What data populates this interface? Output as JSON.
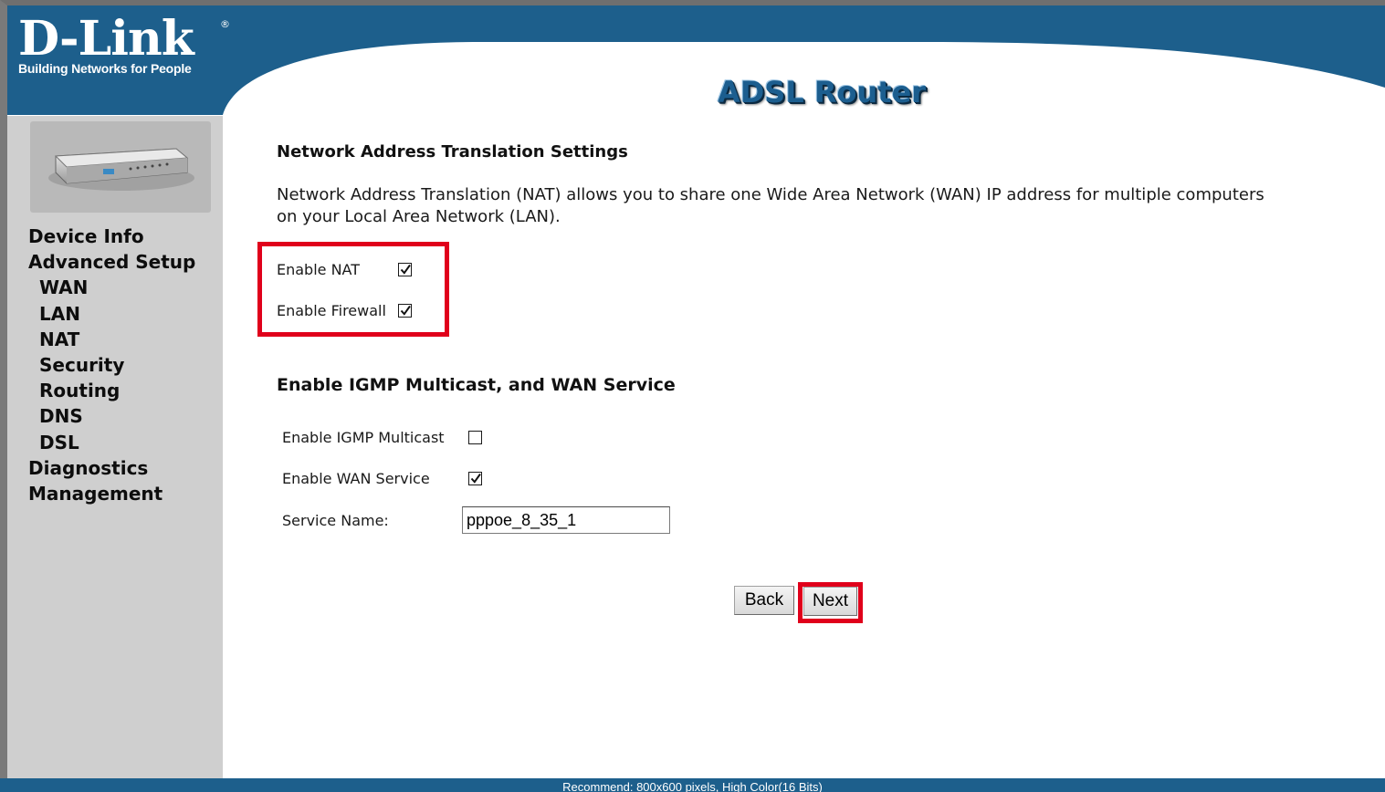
{
  "header": {
    "logo_text": "D-Link",
    "logo_registered": "®",
    "logo_tagline": "Building Networks for People",
    "product_title": "ADSL Router"
  },
  "sidebar": {
    "items": [
      {
        "label": "Device Info"
      },
      {
        "label": "Advanced Setup"
      },
      {
        "label": "WAN"
      },
      {
        "label": "LAN"
      },
      {
        "label": "NAT"
      },
      {
        "label": "Security"
      },
      {
        "label": "Routing"
      },
      {
        "label": "DNS"
      },
      {
        "label": "DSL"
      },
      {
        "label": "Diagnostics"
      },
      {
        "label": "Management"
      }
    ]
  },
  "nat": {
    "title": "Network Address Translation Settings",
    "description": "Network Address Translation (NAT) allows you to share one Wide Area Network (WAN) IP address for multiple computers on your Local Area Network (LAN).",
    "enable_nat_label": "Enable NAT",
    "enable_nat_checked": true,
    "enable_firewall_label": "Enable Firewall",
    "enable_firewall_checked": true
  },
  "igmp": {
    "title": "Enable IGMP Multicast, and WAN Service",
    "igmp_label": "Enable IGMP Multicast",
    "igmp_checked": false,
    "wan_service_label": "Enable WAN Service",
    "wan_service_checked": true,
    "service_name_label": "Service Name:",
    "service_name_value": "pppoe_8_35_1"
  },
  "buttons": {
    "back": "Back",
    "next": "Next"
  },
  "footer": {
    "text": "Recommend: 800x600 pixels, High Color(16 Bits)"
  },
  "colors": {
    "header_blue": "#1d5f8c",
    "sidebar_gray": "#cfcfcf",
    "highlight_red": "#e0001b"
  }
}
